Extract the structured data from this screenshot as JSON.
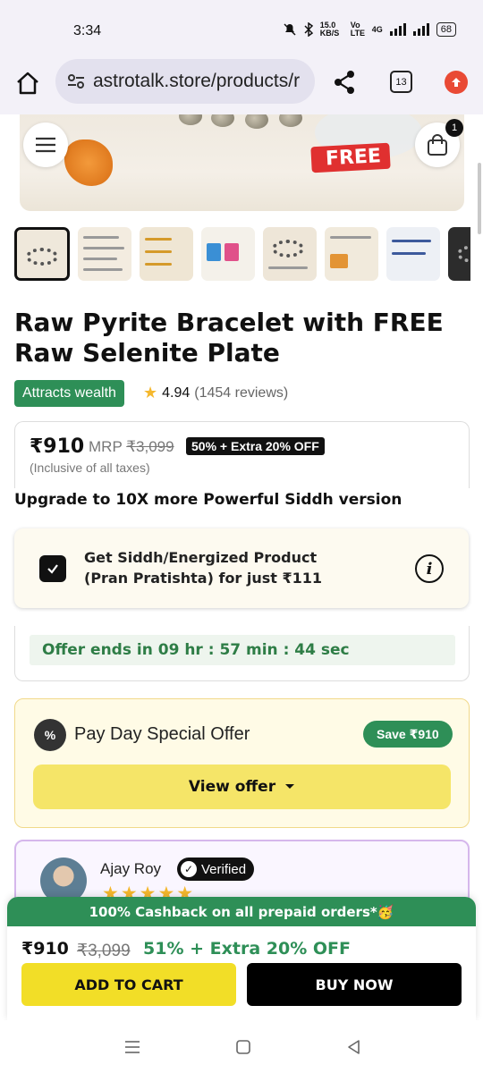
{
  "status_bar": {
    "time": "3:34",
    "net_speed": "15.0 KB/S",
    "volte": "Vo LTE",
    "network": "4G",
    "battery": "68"
  },
  "browser": {
    "url": "astrotalk.store/products/r",
    "tab_count": "13"
  },
  "hero": {
    "free_tag": "FREE",
    "cart_count": "1"
  },
  "thumbnail_count": 8,
  "product": {
    "title": "Raw Pyrite Bracelet with FREE Raw Selenite Plate",
    "tag": "Attracts wealth",
    "rating": "4.94",
    "reviews": "(1454 reviews)",
    "price": "₹910",
    "mrp_label": "MRP",
    "mrp": "₹3,099",
    "discount_badge": "50% + Extra 20% OFF",
    "tax_note": "(Inclusive of all taxes)"
  },
  "upgrade": {
    "heading": "Upgrade to 10X more Powerful Siddh version",
    "line1": "Get Siddh/Energized Product",
    "line2": "(Pran Pratishta) for just ₹111",
    "checked": true
  },
  "timer": {
    "text": "Offer ends in 09 hr : 57 min : 44 sec"
  },
  "payday": {
    "icon_text": "%",
    "title": "Pay Day Special Offer",
    "save": "Save ₹910",
    "button": "View offer"
  },
  "review": {
    "name": "Ajay Roy",
    "verified": "Verified",
    "stars": "★★★★★"
  },
  "sticky": {
    "cashback": "100% Cashback on all prepaid orders*🥳",
    "price": "₹910",
    "mrp": "₹3,099",
    "discount": "51% + Extra 20% OFF",
    "add_to_cart": "ADD TO CART",
    "buy_now": "BUY NOW"
  },
  "colors": {
    "brand_green": "#2e8f57",
    "cta_yellow": "#f2de27",
    "cta_black": "#000000"
  }
}
